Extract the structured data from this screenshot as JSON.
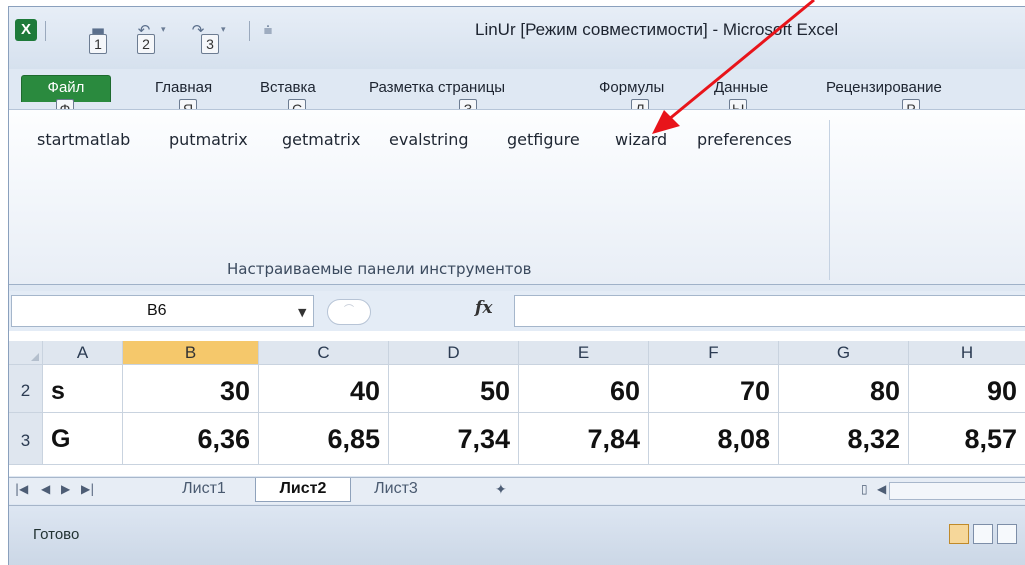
{
  "window": {
    "title": "LinUr  [Режим совместимости]  -  Microsoft Excel",
    "app_icon": "excel-icon"
  },
  "quick_access": {
    "keytips": [
      "1",
      "2",
      "3"
    ],
    "icons": [
      "save-icon",
      "undo-icon",
      "redo-icon",
      "customize-qat-icon"
    ]
  },
  "tabs": [
    {
      "label": "Файл",
      "keytip": "Ф"
    },
    {
      "label": "Главная",
      "keytip": "Я"
    },
    {
      "label": "Вставка",
      "keytip": "С"
    },
    {
      "label": "Разметка страницы",
      "keytip": "З"
    },
    {
      "label": "Формулы",
      "keytip": ""
    },
    {
      "label": "Данные",
      "keytip": "Ы"
    },
    {
      "label": "Рецензирование",
      "keytip": "Р"
    }
  ],
  "mystery_keytip": "Л",
  "ribbon": {
    "buttons": [
      "startmatlab",
      "putmatrix",
      "getmatrix",
      "evalstring",
      "getfigure",
      "wizard",
      "preferences"
    ],
    "group_label": "Настраиваемые панели инструментов"
  },
  "formula_bar": {
    "name_box": "B6",
    "fx_label": "fx",
    "value": ""
  },
  "grid": {
    "columns": [
      "A",
      "B",
      "C",
      "D",
      "E",
      "F",
      "G",
      "H"
    ],
    "selected_column": "B",
    "rows": [
      {
        "num": "2",
        "label": "s",
        "values": [
          "30",
          "40",
          "50",
          "60",
          "70",
          "80",
          "90"
        ]
      },
      {
        "num": "3",
        "label": "G",
        "values": [
          "6,36",
          "6,85",
          "7,34",
          "7,84",
          "8,08",
          "8,32",
          "8,57"
        ]
      }
    ]
  },
  "sheets": {
    "tabs": [
      "Лист1",
      "Лист2",
      "Лист3"
    ],
    "active": "Лист2"
  },
  "status": {
    "text": "Готово"
  },
  "colors": {
    "file_tab": "#2a8a3e",
    "selected_header": "#f5c86b",
    "annotation_arrow": "#e8141a"
  }
}
